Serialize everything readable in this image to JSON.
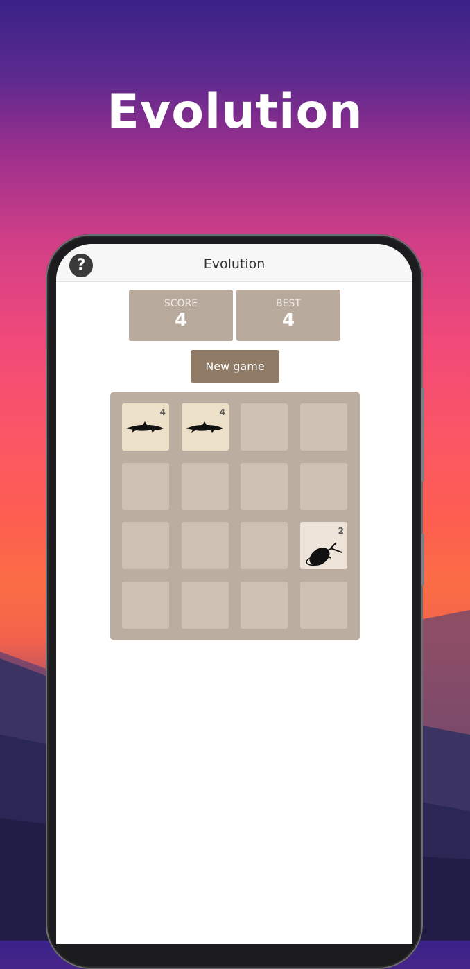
{
  "hero": {
    "title": "Evolution"
  },
  "appbar": {
    "title": "Evolution",
    "help_icon": "?"
  },
  "scores": {
    "score_label": "SCORE",
    "score_value": "4",
    "best_label": "BEST",
    "best_value": "4"
  },
  "controls": {
    "new_game_label": "New game"
  },
  "board": {
    "rows": 4,
    "cols": 4,
    "tiles": [
      {
        "row": 0,
        "col": 0,
        "value": "4",
        "icon": "dolphin-icon"
      },
      {
        "row": 0,
        "col": 1,
        "value": "4",
        "icon": "dolphin-icon"
      },
      {
        "row": 2,
        "col": 3,
        "value": "2",
        "icon": "beetle-icon"
      }
    ]
  },
  "colors": {
    "board": "#bbada0",
    "empty_tile": "#cdc1b4",
    "tile_4": "#ede0c8",
    "tile_2": "#eee4da",
    "new_game_button": "#8f7a66",
    "score_box": "#b8aa9c"
  }
}
